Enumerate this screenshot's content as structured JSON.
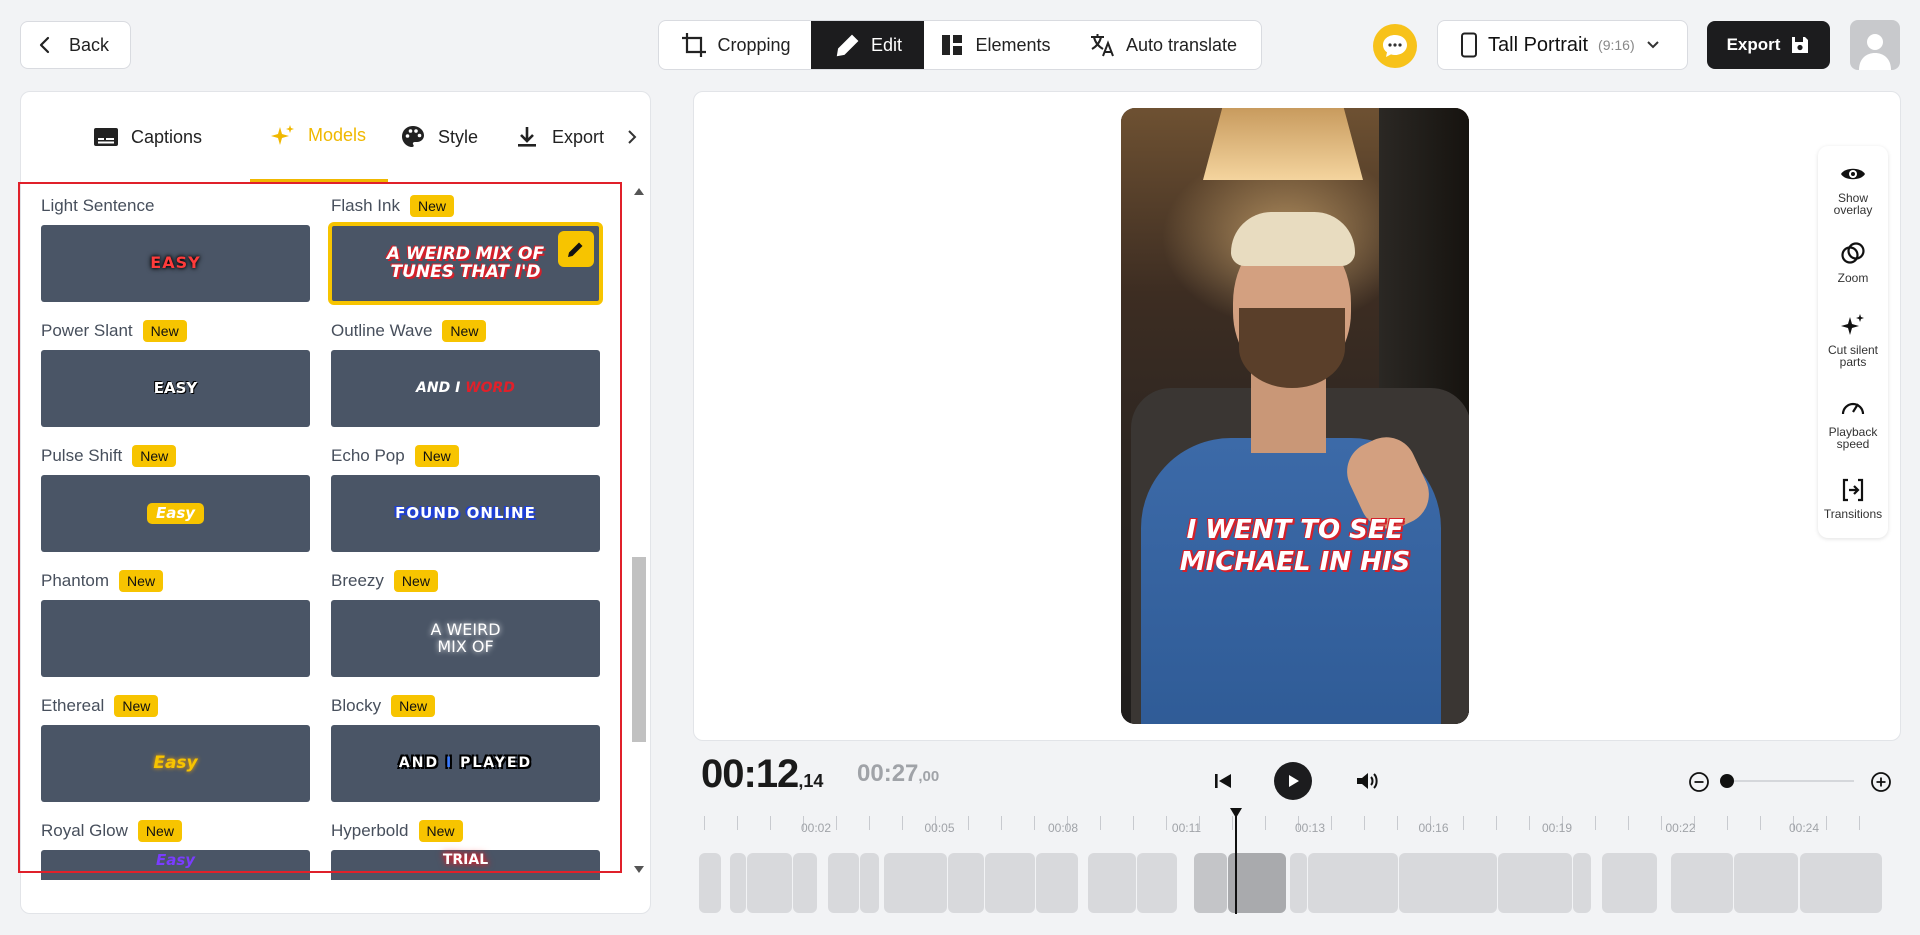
{
  "header": {
    "back_label": "Back",
    "modes": [
      {
        "label": "Cropping",
        "icon": "crop-icon"
      },
      {
        "label": "Edit",
        "icon": "pencil-icon",
        "active": true
      },
      {
        "label": "Elements",
        "icon": "layout-icon"
      },
      {
        "label": "Auto translate",
        "icon": "translate-icon"
      }
    ],
    "aspect_label": "Tall Portrait",
    "aspect_ratio": "(9:16)",
    "export_label": "Export"
  },
  "left_panel": {
    "tabs": [
      {
        "label": "Captions",
        "icon": "captions-icon"
      },
      {
        "label": "Models",
        "icon": "sparkles-icon",
        "active": true
      },
      {
        "label": "Style",
        "icon": "palette-icon"
      },
      {
        "label": "Export",
        "icon": "download-icon"
      }
    ],
    "new_badge": "New",
    "models": [
      {
        "name": "Light Sentence",
        "is_new": false,
        "preview": "EASY"
      },
      {
        "name": "Flash Ink",
        "is_new": true,
        "preview_lines": [
          "A WEIRD MIX OF",
          "TUNES THAT I'D"
        ],
        "selected": true
      },
      {
        "name": "Power Slant",
        "is_new": true,
        "preview": "EASY"
      },
      {
        "name": "Outline Wave",
        "is_new": true,
        "preview_a": "AND I",
        "preview_b": "WORD"
      },
      {
        "name": "Pulse Shift",
        "is_new": true,
        "preview": "Easy"
      },
      {
        "name": "Echo Pop",
        "is_new": true,
        "preview": "FOUND ONLINE"
      },
      {
        "name": "Phantom",
        "is_new": true,
        "preview": ""
      },
      {
        "name": "Breezy",
        "is_new": true,
        "preview_lines": [
          "A WEIRD",
          "MIX OF"
        ]
      },
      {
        "name": "Ethereal",
        "is_new": true,
        "preview": "Easy"
      },
      {
        "name": "Blocky",
        "is_new": true,
        "preview_a": "AND",
        "preview_b": "I",
        "preview_c": "PLAYED"
      },
      {
        "name": "Royal Glow",
        "is_new": true,
        "preview": "Easy"
      },
      {
        "name": "Hyperbold",
        "is_new": true,
        "preview": "TRIAL"
      }
    ]
  },
  "preview": {
    "caption_lines": [
      "I WENT TO SEE",
      "MICHAEL IN HIS"
    ],
    "tools": [
      {
        "label": "Show overlay",
        "icon": "eye-icon"
      },
      {
        "label": "Zoom",
        "icon": "zoom-rings-icon"
      },
      {
        "label": "Cut silent parts",
        "icon": "sparkles-icon"
      },
      {
        "label": "Playback speed",
        "icon": "gauge-icon"
      },
      {
        "label": "Transitions",
        "icon": "transitions-icon"
      }
    ]
  },
  "playback": {
    "current_main": "00:12",
    "current_frac": ",14",
    "total_main": "00:27",
    "total_frac": ",00",
    "zoom_level": 0.0
  },
  "timeline": {
    "tick_labels": [
      "00:02",
      "00:05",
      "00:08",
      "00:11",
      "00:13",
      "00:16",
      "00:19",
      "00:22",
      "00:24"
    ],
    "playhead_time": 12.14
  },
  "colors": {
    "accent": "#f7c400",
    "dark": "#1c1c1e",
    "thumb_bg": "#4a5566",
    "highlight": "#e0202a"
  }
}
